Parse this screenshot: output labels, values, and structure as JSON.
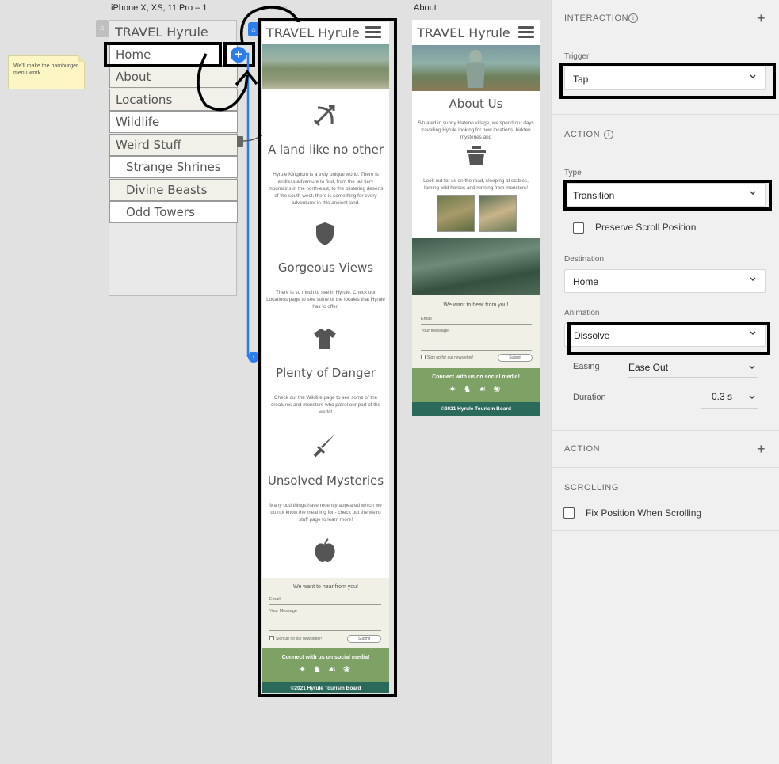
{
  "canvas": {
    "artboard_menu_title": "iPhone X, XS, 11 Pro – 1",
    "artboard_home_title": "Home",
    "artboard_about_title": "About",
    "note_text": "We'll make the hamburger menu work"
  },
  "menu": {
    "title": "TRAVEL Hyrule",
    "items": [
      {
        "label": "Home"
      },
      {
        "label": "About"
      },
      {
        "label": "Locations"
      },
      {
        "label": "Wildlife"
      },
      {
        "label": "Weird Stuff"
      },
      {
        "label": "Strange Shrines"
      },
      {
        "label": "Divine Beasts"
      },
      {
        "label": "Odd Towers"
      }
    ]
  },
  "home": {
    "title": "TRAVEL Hyrule",
    "sections": [
      {
        "icon": "bow-arrow-icon",
        "title": "A land like no other",
        "text": "Hyrule Kingdom is a truly unique world. There is endless adventure to find, from the tall fiery mountains in the north-east, to the blistering deserts of the south-west, there is something for every adventurer in this ancient land."
      },
      {
        "icon": "shield-icon",
        "title": "Gorgeous Views",
        "text": "There is so much to see in Hyrule. Check our Locations page to see some of the locales that Hyrule has to offer!"
      },
      {
        "icon": "tunic-icon",
        "title": "Plenty of Danger",
        "text": "Check out the Wildlife page to see some of the creatures and monsters who patrol our part of the world!"
      },
      {
        "icon": "sword-icon",
        "title": "Unsolved Mysteries",
        "text": "Many odd things have recently appeared which we do not know the meaning for - check out the weird stuff page to learn more!"
      }
    ],
    "apple_icon": "apple-icon",
    "contact_title": "We want to hear from you!",
    "email_label": "Email",
    "message_label": "Your Message",
    "newsletter_label": "Sign up for our newsletter!",
    "submit_label": "Submit",
    "social_title": "Connect with us on social media!",
    "footer": "©2021 Hyrule Tourism Board"
  },
  "about": {
    "title": "TRAVEL Hyrule",
    "heading": "About Us",
    "intro": "Situated in sunny Hateno village, we spend our days travelling Hyrule looking for new locations, hidden mysteries and",
    "pot_icon": "cooking-pot-icon",
    "road_text": "Look out for us on the road, sleeping at stables, taming wild horses and running from monsters!",
    "contact_title": "We want to hear from you!",
    "email_label": "Email",
    "message_label": "Your Message",
    "newsletter_label": "Sign up for our newsletter!",
    "submit_label": "Submit",
    "social_title": "Connect with us on social media!",
    "footer": "©2021 Hyrule Tourism Board"
  },
  "panel": {
    "interaction_heading": "INTERACTION",
    "trigger_label": "Trigger",
    "trigger_value": "Tap",
    "action_heading": "ACTION",
    "type_label": "Type",
    "type_value": "Transition",
    "preserve_scroll_label": "Preserve Scroll Position",
    "preserve_scroll_checked": false,
    "destination_label": "Destination",
    "destination_value": "Home",
    "animation_label": "Animation",
    "animation_value": "Dissolve",
    "easing_label": "Easing",
    "easing_value": "Ease Out",
    "duration_label": "Duration",
    "duration_value": "0.3 s",
    "action2_heading": "ACTION",
    "scrolling_heading": "SCROLLING",
    "fix_position_label": "Fix Position When Scrolling",
    "fix_position_checked": false
  },
  "colors": {
    "accent_blue": "#2b7de9",
    "social_green": "#7ea166",
    "footer_teal": "#2b6a5a",
    "contact_bg": "#f0f0e6",
    "highlight": "#000000"
  }
}
